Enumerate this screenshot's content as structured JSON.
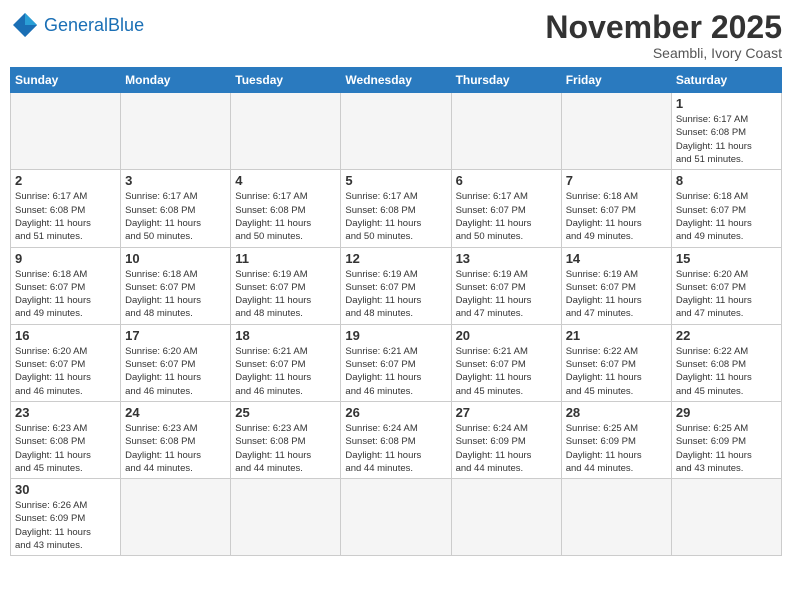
{
  "header": {
    "logo_general": "General",
    "logo_blue": "Blue",
    "month_title": "November 2025",
    "location": "Seambli, Ivory Coast"
  },
  "weekdays": [
    "Sunday",
    "Monday",
    "Tuesday",
    "Wednesday",
    "Thursday",
    "Friday",
    "Saturday"
  ],
  "weeks": [
    [
      {
        "day": "",
        "info": ""
      },
      {
        "day": "",
        "info": ""
      },
      {
        "day": "",
        "info": ""
      },
      {
        "day": "",
        "info": ""
      },
      {
        "day": "",
        "info": ""
      },
      {
        "day": "",
        "info": ""
      },
      {
        "day": "1",
        "info": "Sunrise: 6:17 AM\nSunset: 6:08 PM\nDaylight: 11 hours\nand 51 minutes."
      }
    ],
    [
      {
        "day": "2",
        "info": "Sunrise: 6:17 AM\nSunset: 6:08 PM\nDaylight: 11 hours\nand 51 minutes."
      },
      {
        "day": "3",
        "info": "Sunrise: 6:17 AM\nSunset: 6:08 PM\nDaylight: 11 hours\nand 50 minutes."
      },
      {
        "day": "4",
        "info": "Sunrise: 6:17 AM\nSunset: 6:08 PM\nDaylight: 11 hours\nand 50 minutes."
      },
      {
        "day": "5",
        "info": "Sunrise: 6:17 AM\nSunset: 6:08 PM\nDaylight: 11 hours\nand 50 minutes."
      },
      {
        "day": "6",
        "info": "Sunrise: 6:17 AM\nSunset: 6:07 PM\nDaylight: 11 hours\nand 50 minutes."
      },
      {
        "day": "7",
        "info": "Sunrise: 6:18 AM\nSunset: 6:07 PM\nDaylight: 11 hours\nand 49 minutes."
      },
      {
        "day": "8",
        "info": "Sunrise: 6:18 AM\nSunset: 6:07 PM\nDaylight: 11 hours\nand 49 minutes."
      }
    ],
    [
      {
        "day": "9",
        "info": "Sunrise: 6:18 AM\nSunset: 6:07 PM\nDaylight: 11 hours\nand 49 minutes."
      },
      {
        "day": "10",
        "info": "Sunrise: 6:18 AM\nSunset: 6:07 PM\nDaylight: 11 hours\nand 48 minutes."
      },
      {
        "day": "11",
        "info": "Sunrise: 6:19 AM\nSunset: 6:07 PM\nDaylight: 11 hours\nand 48 minutes."
      },
      {
        "day": "12",
        "info": "Sunrise: 6:19 AM\nSunset: 6:07 PM\nDaylight: 11 hours\nand 48 minutes."
      },
      {
        "day": "13",
        "info": "Sunrise: 6:19 AM\nSunset: 6:07 PM\nDaylight: 11 hours\nand 47 minutes."
      },
      {
        "day": "14",
        "info": "Sunrise: 6:19 AM\nSunset: 6:07 PM\nDaylight: 11 hours\nand 47 minutes."
      },
      {
        "day": "15",
        "info": "Sunrise: 6:20 AM\nSunset: 6:07 PM\nDaylight: 11 hours\nand 47 minutes."
      }
    ],
    [
      {
        "day": "16",
        "info": "Sunrise: 6:20 AM\nSunset: 6:07 PM\nDaylight: 11 hours\nand 46 minutes."
      },
      {
        "day": "17",
        "info": "Sunrise: 6:20 AM\nSunset: 6:07 PM\nDaylight: 11 hours\nand 46 minutes."
      },
      {
        "day": "18",
        "info": "Sunrise: 6:21 AM\nSunset: 6:07 PM\nDaylight: 11 hours\nand 46 minutes."
      },
      {
        "day": "19",
        "info": "Sunrise: 6:21 AM\nSunset: 6:07 PM\nDaylight: 11 hours\nand 46 minutes."
      },
      {
        "day": "20",
        "info": "Sunrise: 6:21 AM\nSunset: 6:07 PM\nDaylight: 11 hours\nand 45 minutes."
      },
      {
        "day": "21",
        "info": "Sunrise: 6:22 AM\nSunset: 6:07 PM\nDaylight: 11 hours\nand 45 minutes."
      },
      {
        "day": "22",
        "info": "Sunrise: 6:22 AM\nSunset: 6:08 PM\nDaylight: 11 hours\nand 45 minutes."
      }
    ],
    [
      {
        "day": "23",
        "info": "Sunrise: 6:23 AM\nSunset: 6:08 PM\nDaylight: 11 hours\nand 45 minutes."
      },
      {
        "day": "24",
        "info": "Sunrise: 6:23 AM\nSunset: 6:08 PM\nDaylight: 11 hours\nand 44 minutes."
      },
      {
        "day": "25",
        "info": "Sunrise: 6:23 AM\nSunset: 6:08 PM\nDaylight: 11 hours\nand 44 minutes."
      },
      {
        "day": "26",
        "info": "Sunrise: 6:24 AM\nSunset: 6:08 PM\nDaylight: 11 hours\nand 44 minutes."
      },
      {
        "day": "27",
        "info": "Sunrise: 6:24 AM\nSunset: 6:09 PM\nDaylight: 11 hours\nand 44 minutes."
      },
      {
        "day": "28",
        "info": "Sunrise: 6:25 AM\nSunset: 6:09 PM\nDaylight: 11 hours\nand 44 minutes."
      },
      {
        "day": "29",
        "info": "Sunrise: 6:25 AM\nSunset: 6:09 PM\nDaylight: 11 hours\nand 43 minutes."
      }
    ],
    [
      {
        "day": "30",
        "info": "Sunrise: 6:26 AM\nSunset: 6:09 PM\nDaylight: 11 hours\nand 43 minutes."
      },
      {
        "day": "",
        "info": ""
      },
      {
        "day": "",
        "info": ""
      },
      {
        "day": "",
        "info": ""
      },
      {
        "day": "",
        "info": ""
      },
      {
        "day": "",
        "info": ""
      },
      {
        "day": "",
        "info": ""
      }
    ]
  ]
}
